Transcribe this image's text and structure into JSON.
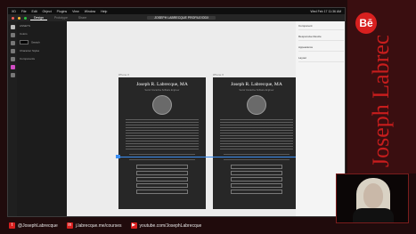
{
  "menubar": {
    "items": [
      "XD",
      "File",
      "Edit",
      "Object",
      "Plugins",
      "View",
      "Window",
      "Help"
    ],
    "clock": "Wed Feb 17 11:36 AM"
  },
  "app": {
    "tabs": [
      "Design",
      "Prototype",
      "Share"
    ],
    "document_title": "JOSEPH LABRECQUE PROFILE/ODX"
  },
  "layers_panel": {
    "title": "ASSETS",
    "colors_label": "Colors",
    "color_name": "Swatch",
    "char_styles_label": "Character Styles",
    "components_label": "Components"
  },
  "artboards": [
    {
      "label": "iPhone X",
      "name": "Joseph R. Labrecque, MA",
      "subtitle": "Senior Interactive Software Engineer"
    },
    {
      "label": "iPhone X",
      "name": "Joseph R. Labrecque, MA",
      "subtitle": "Senior Interactive Software Engineer"
    }
  ],
  "props_panel": {
    "section1": "Component",
    "section2": "Responsive Resize",
    "section3": "Appearance",
    "section4": "Layout"
  },
  "branding": {
    "badge": "Bē",
    "vertical_name": "Joseph Labrecque",
    "accent": "#d8201f"
  },
  "footer": {
    "twitter": "@JosephLabrecque",
    "linkedin": "j.labrecque.me/courses",
    "youtube": "youtube.com/JosephLabrecque"
  }
}
